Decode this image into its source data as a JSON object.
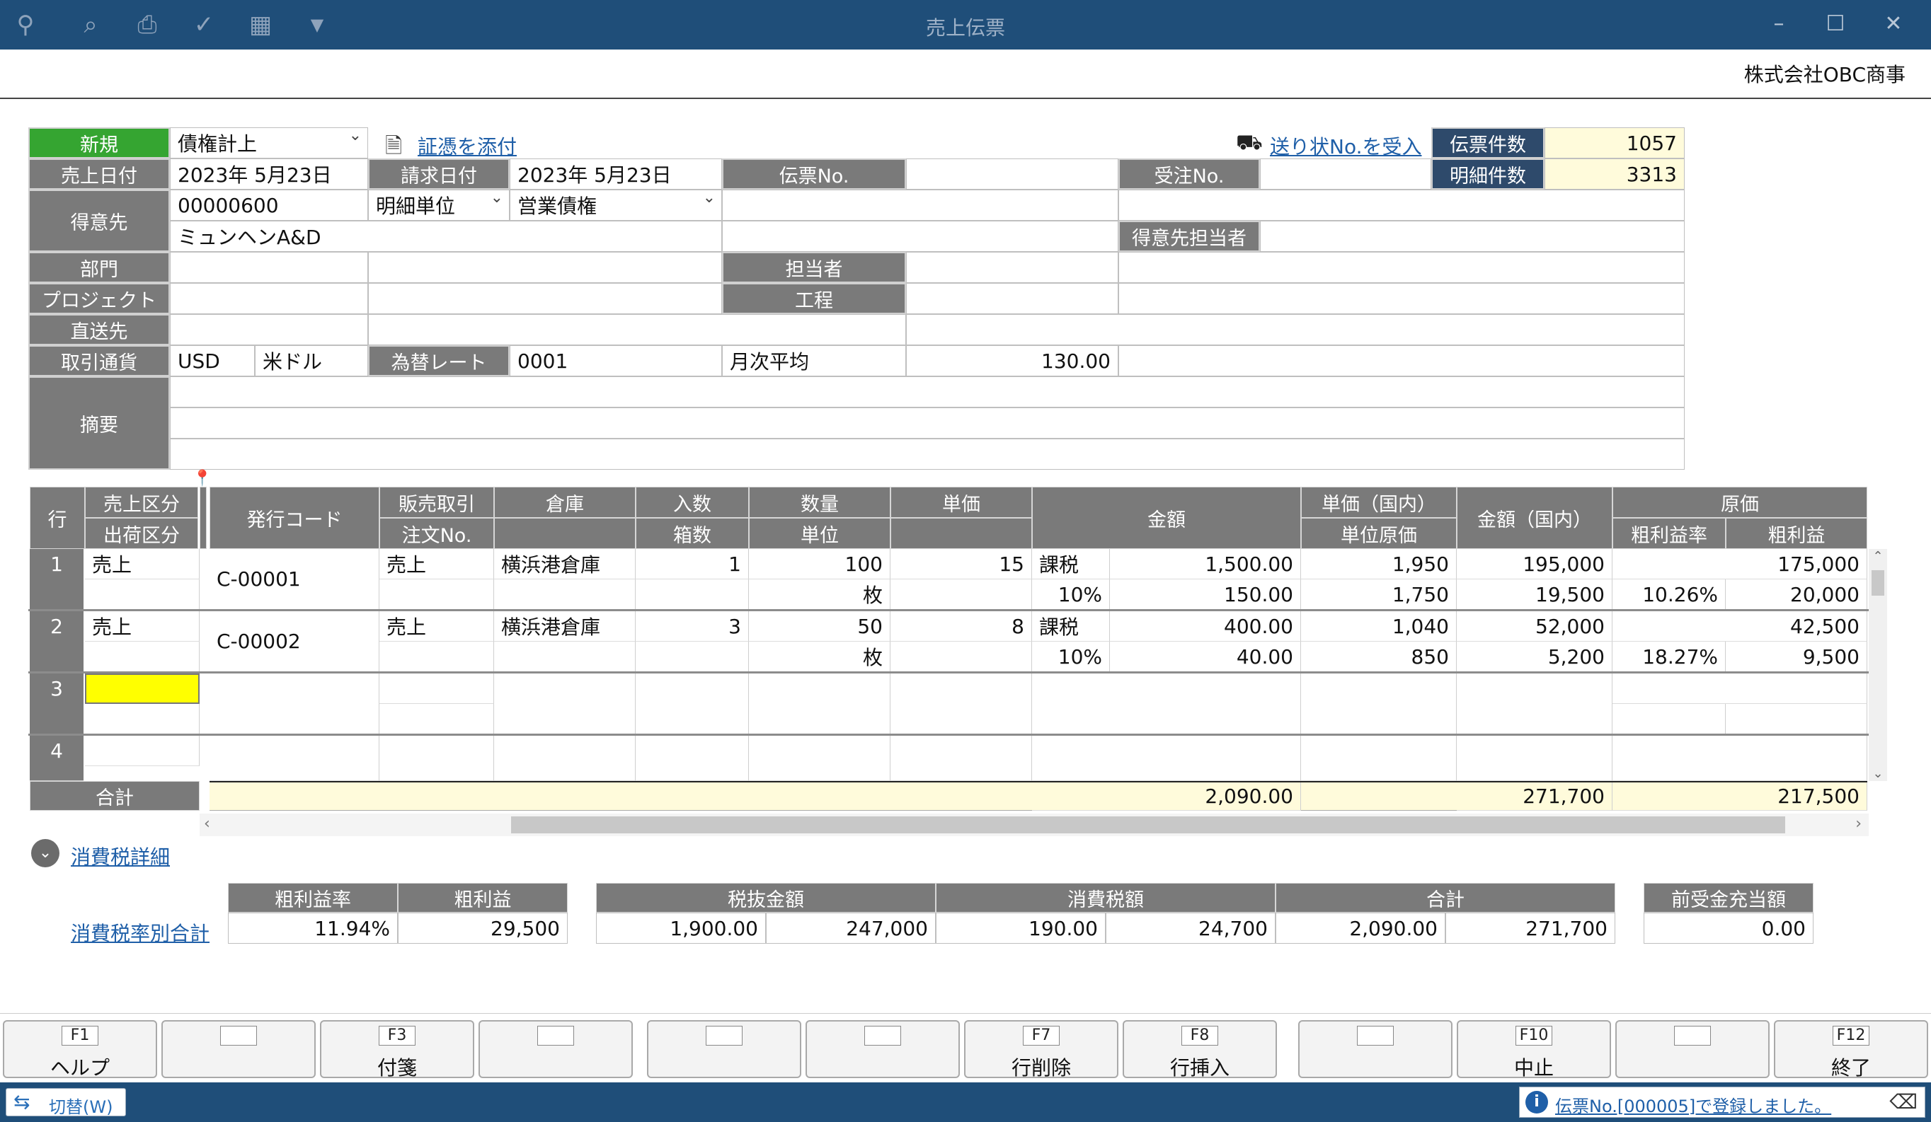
{
  "window": {
    "title": "売上伝票",
    "company": "株式会社OBC商事"
  },
  "toolbar": {
    "icons": [
      "search-plus-icon",
      "zoom-icon",
      "print-icon",
      "spellcheck-icon",
      "excel-icon",
      "dropdown-icon"
    ]
  },
  "header": {
    "new_label": "新規",
    "type_value": "債権計上",
    "attach_link": "証憑を添付",
    "invoice_link": "送り状No.を受入",
    "slip_count_label": "伝票件数",
    "slip_count": "1057",
    "detail_count_label": "明細件数",
    "detail_count": "3313",
    "sales_date_label": "売上日付",
    "sales_date": "2023年  5月23日",
    "bill_date_label": "請求日付",
    "bill_date": "2023年  5月23日",
    "slip_no_label": "伝票No.",
    "slip_no": "",
    "order_no_label": "受注No.",
    "order_no": "",
    "customer_label": "得意先",
    "customer_code": "00000600",
    "customer_name": "ミュンヘンA&D",
    "detail_unit": "明細単位",
    "receivable": "営業債権",
    "customer_rep_label": "得意先担当者",
    "dept_label": "部門",
    "person_label": "担当者",
    "project_label": "プロジェクト",
    "process_label": "工程",
    "direct_label": "直送先",
    "currency_label": "取引通貨",
    "currency_code": "USD",
    "currency_name": "米ドル",
    "rate_label": "為替レート",
    "rate_code": "0001",
    "rate_name": "月次平均",
    "rate_value": "130.00",
    "memo_label": "摘要"
  },
  "grid": {
    "headers": {
      "row": "行",
      "sales_type": "売上区分",
      "ship_type": "出荷区分",
      "issue_code": "発行コード",
      "sales_deal": "販売取引",
      "order_no": "注文No.",
      "warehouse": "倉庫",
      "per_box": "入数",
      "boxes": "箱数",
      "qty": "数量",
      "unit": "単位",
      "unit_price": "単価",
      "amount": "金額",
      "unit_price_dom": "単価（国内）",
      "unit_cost": "単位原価",
      "amount_dom": "金額（国内）",
      "cost": "原価",
      "margin_rate": "粗利益率",
      "margin": "粗利益"
    },
    "rows": [
      {
        "no": "1",
        "sales_type": "売上",
        "issue_code": "C-00001",
        "sales_deal": "売上",
        "warehouse": "横浜港倉庫",
        "per_box": "1",
        "qty": "100",
        "unit": "枚",
        "unit_price": "15",
        "tax_kind": "課税",
        "tax_rate": "10%",
        "amount": "1,500.00",
        "tax": "150.00",
        "unit_price_dom": "1,950",
        "unit_cost": "1,750",
        "amount_dom": "195,000",
        "tax_dom": "19,500",
        "cost": "175,000",
        "margin_rate": "10.26%",
        "margin": "20,000"
      },
      {
        "no": "2",
        "sales_type": "売上",
        "issue_code": "C-00002",
        "sales_deal": "売上",
        "warehouse": "横浜港倉庫",
        "per_box": "3",
        "qty": "50",
        "unit": "枚",
        "unit_price": "8",
        "tax_kind": "課税",
        "tax_rate": "10%",
        "amount": "400.00",
        "tax": "40.00",
        "unit_price_dom": "1,040",
        "unit_cost": "850",
        "amount_dom": "52,000",
        "tax_dom": "5,200",
        "cost": "42,500",
        "margin_rate": "18.27%",
        "margin": "9,500"
      },
      {
        "no": "3"
      },
      {
        "no": "4"
      }
    ],
    "total_label": "合計",
    "total_amount": "2,090.00",
    "total_amount_dom": "271,700",
    "total_cost": "217,500"
  },
  "tax_detail": {
    "toggle_label": "消費税詳細",
    "rate_total_link": "消費税率別合計",
    "margin_rate_label": "粗利益率",
    "margin_rate": "11.94%",
    "margin_label": "粗利益",
    "margin": "29,500",
    "net_label": "税抜金額",
    "net": "1,900.00",
    "net_dom": "247,000",
    "tax_label": "消費税額",
    "tax": "190.00",
    "tax_dom": "24,700",
    "sum_label": "合計",
    "sum": "2,090.00",
    "sum_dom": "271,700",
    "advance_label": "前受金充当額",
    "advance": "0.00"
  },
  "fkeys": [
    {
      "key": "F1",
      "label": "ヘルプ"
    },
    {
      "key": "",
      "label": ""
    },
    {
      "key": "F3",
      "label": "付箋"
    },
    {
      "key": "",
      "label": ""
    },
    {
      "key": "",
      "label": ""
    },
    {
      "key": "",
      "label": ""
    },
    {
      "key": "F7",
      "label": "行削除"
    },
    {
      "key": "F8",
      "label": "行挿入"
    },
    {
      "key": "",
      "label": ""
    },
    {
      "key": "F10",
      "label": "中止"
    },
    {
      "key": "",
      "label": ""
    },
    {
      "key": "F12",
      "label": "終了"
    }
  ],
  "status": {
    "switch_label": "切替(W)",
    "message": "伝票No.[000005]で登録しました。"
  },
  "colors": {
    "titlebar": "#1f4e79",
    "label_gray": "#7a7a7a",
    "label_dark": "#2e4a6b",
    "new_green": "#35a531",
    "active_orange": "#f2821d",
    "total_bg": "#fffbdb",
    "active_cell": "#ffff00"
  }
}
